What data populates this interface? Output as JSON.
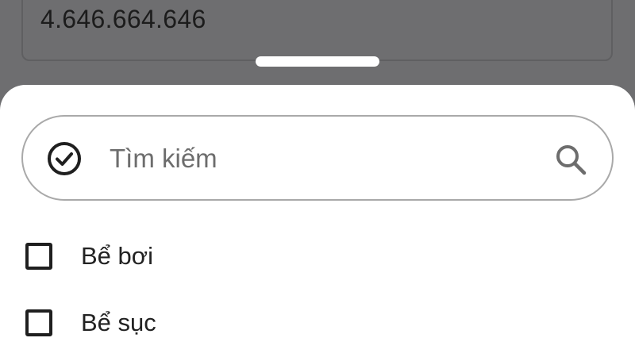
{
  "background_field": {
    "value": "4.646.664.646"
  },
  "search": {
    "placeholder": "Tìm kiếm",
    "leading_icon": "check-circle-icon",
    "trailing_icon": "search-icon"
  },
  "options": [
    {
      "label": "Bể bơi",
      "checked": false
    },
    {
      "label": "Bể sục",
      "checked": false
    }
  ],
  "colors": {
    "scrim": "#6e6e70",
    "sheet": "#ffffff",
    "search_border": "#a9a9a9",
    "text_primary": "#222222",
    "placeholder": "#6d6d6d"
  }
}
